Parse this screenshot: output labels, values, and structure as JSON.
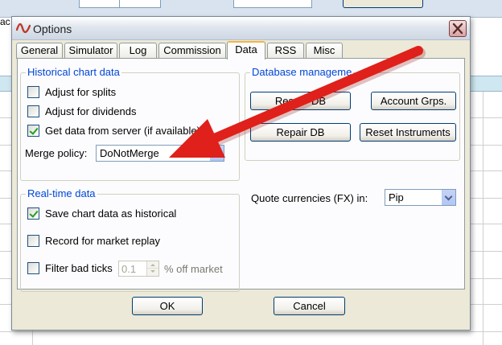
{
  "background": {
    "left_label": "ac"
  },
  "dialog": {
    "title": "Options",
    "close_glyph": "✕",
    "tabs": [
      {
        "label": "General"
      },
      {
        "label": "Simulator"
      },
      {
        "label": "Log"
      },
      {
        "label": "Commission"
      },
      {
        "label": "Data",
        "active": true
      },
      {
        "label": "RSS"
      },
      {
        "label": "Misc"
      }
    ],
    "historical": {
      "title": "Historical chart data",
      "adjust_splits": {
        "label": "Adjust for splits",
        "checked": false
      },
      "adjust_dividends": {
        "label": "Adjust for dividends",
        "checked": false
      },
      "get_data": {
        "label": "Get data from server (if available)",
        "checked": true
      },
      "merge_policy_label": "Merge policy:",
      "merge_policy_value": "DoNotMerge"
    },
    "database": {
      "title": "Database manageme",
      "reset_db_pre": "Res",
      "reset_db_post": "DB",
      "account_grps": "Account Grps.",
      "repair_db": "Repair DB",
      "reset_instruments": "Reset Instruments"
    },
    "realtime": {
      "title": "Real-time data",
      "save_chart": {
        "label": "Save chart data as historical",
        "checked": true
      },
      "record_replay": {
        "label": "Record for market replay",
        "checked": false
      },
      "filter_ticks": {
        "label": "Filter bad ticks",
        "checked": false
      },
      "filter_value": "0.1",
      "filter_suffix": "% off market"
    },
    "quote_currencies": {
      "label": "Quote currencies (FX) in:",
      "value": "Pip"
    },
    "ok_label": "OK",
    "cancel_label": "Cancel"
  },
  "colors": {
    "group_title": "#0046d5",
    "arrow": "#e0201a",
    "active_tab_accent": "#f1b543"
  },
  "icons": {
    "app": "app-logo-icon",
    "close": "close-icon",
    "checkbox": "checkmark-icon",
    "dropdown": "chevron-down-icon",
    "annotation": "red-arrow-annotation"
  }
}
